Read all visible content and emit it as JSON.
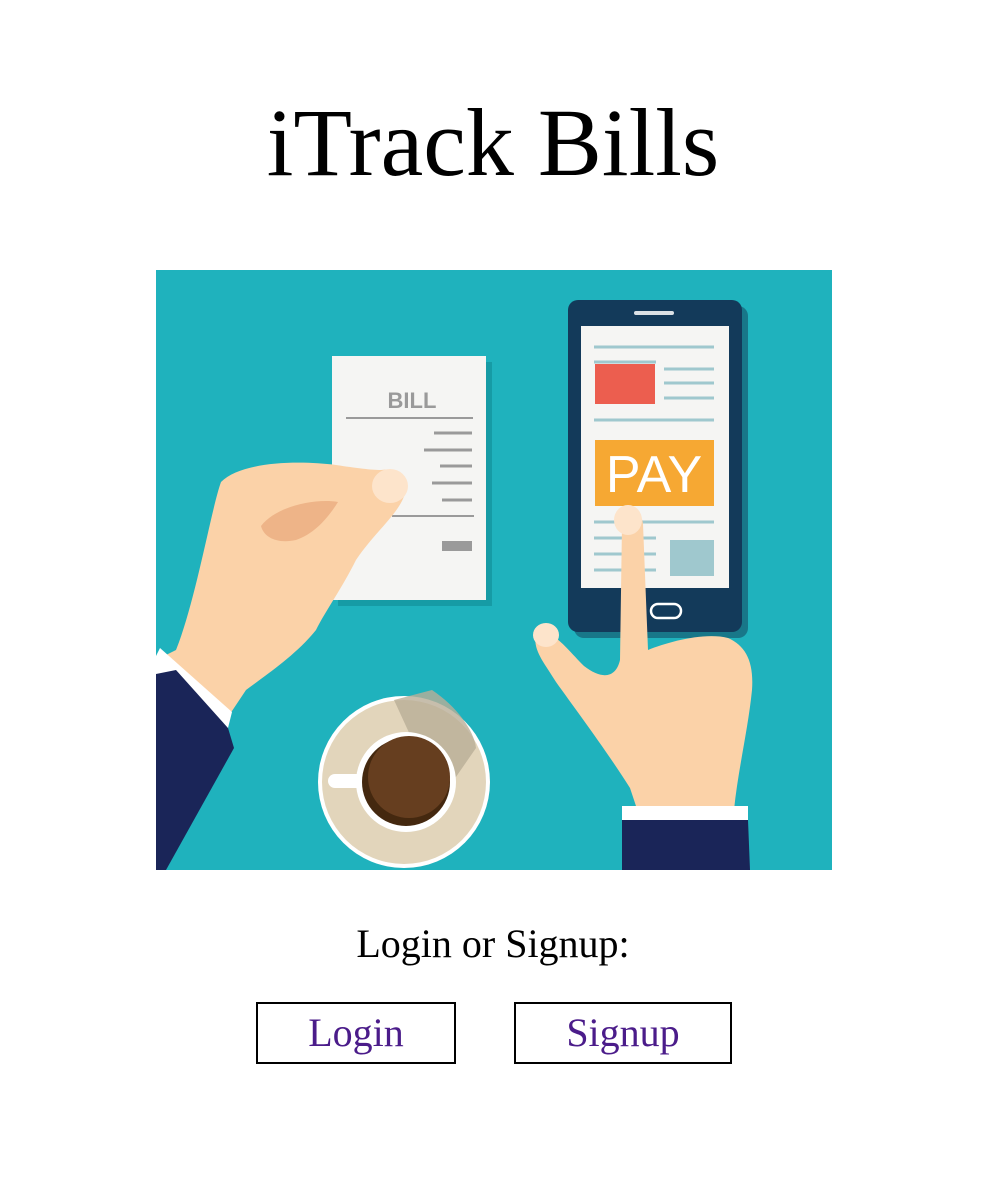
{
  "header": {
    "title": "iTrack Bills"
  },
  "hero": {
    "bill_label": "BILL",
    "pay_label": "PAY",
    "colors": {
      "background": "#1fb2bd",
      "phone": "#133a5a",
      "pay_button": "#f6a833",
      "red_block": "#ec5e4f",
      "skin": "#fbd2a8",
      "sleeve": "#1a2558",
      "coffee": "#663e1f"
    }
  },
  "auth": {
    "prompt": "Login or Signup:",
    "login_label": "Login",
    "signup_label": "Signup",
    "link_color": "#4b1c8a"
  }
}
